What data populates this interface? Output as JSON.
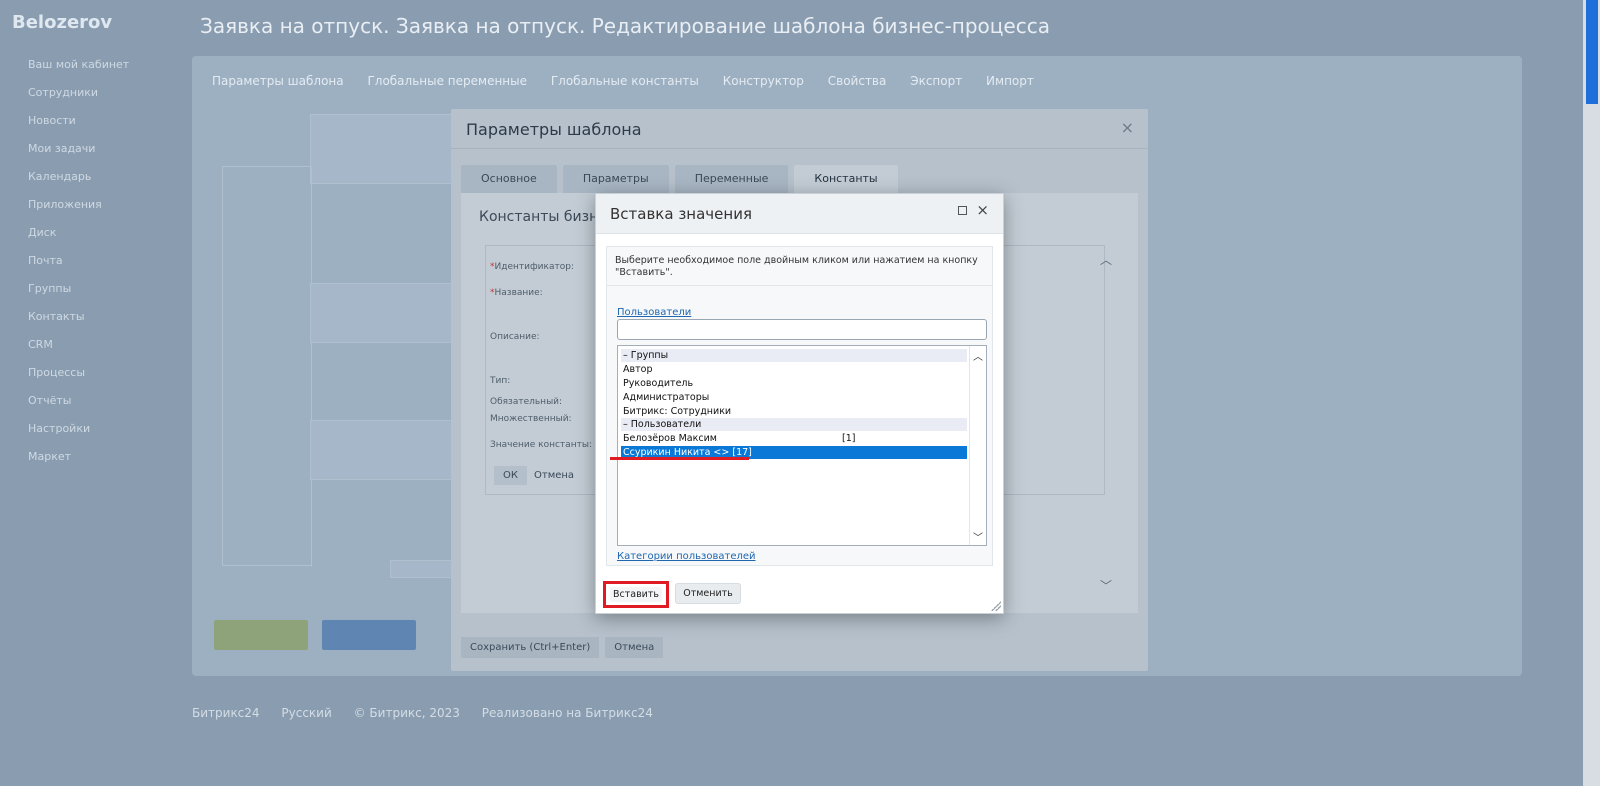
{
  "background": {
    "app_title": "Belozerov",
    "page_title": "Заявка на отпуск. Заявка на отпуск. Редактирование шаблона бизнес-процесса",
    "sidebar_items": [
      "Ваш мой кабинет",
      "Сотрудники",
      "Новости",
      "Мои задачи",
      "Календарь",
      "Приложения",
      "Диск",
      "Почта",
      "Группы",
      "Контакты",
      "CRM",
      "Процессы",
      "Отчёты",
      "Настройки",
      "Маркет"
    ],
    "content_tabs": [
      "Параметры шаблона",
      "Глобальные переменные",
      "Глобальные константы",
      "Конструктор",
      "Свойства",
      "Экспорт",
      "Импорт"
    ],
    "footer": [
      "Битрикс24",
      "Русский",
      "© Битрикс, 2023",
      "Реализовано на Битрикс24"
    ]
  },
  "template_dialog": {
    "title": "Параметры шаблона",
    "close": "×",
    "tabs": [
      {
        "label": "Основное",
        "active": false
      },
      {
        "label": "Параметры",
        "active": false
      },
      {
        "label": "Переменные",
        "active": false
      },
      {
        "label": "Константы",
        "active": true
      }
    ],
    "subtitle": "Константы бизнес",
    "form_labels": {
      "identifier": "Идентификатор:",
      "name": "Название:",
      "description": "Описание:",
      "type": "Тип:",
      "required": "Обязательный:",
      "multiple": "Множественный:",
      "value": "Значение константы:"
    },
    "ok": "ОК",
    "cancel": "Отмена",
    "footer_save": "Сохранить (Ctrl+Enter)",
    "footer_cancel": "Отмена"
  },
  "insert_modal": {
    "title": "Вставка значения",
    "maximize": "",
    "close": "×",
    "hint": "Выберите необходимое поле двойным кликом или нажатием на кнопку \"Вставить\".",
    "users_link": "Пользователи",
    "search_value": "",
    "list": [
      {
        "text": "– Группы",
        "type": "group",
        "id": ""
      },
      {
        "text": "Автор",
        "type": "item",
        "id": ""
      },
      {
        "text": "Руководитель",
        "type": "item",
        "id": ""
      },
      {
        "text": "Администраторы",
        "type": "item",
        "id": ""
      },
      {
        "text": "Битрикс: Сотрудники",
        "type": "item",
        "id": ""
      },
      {
        "text": "– Пользователи",
        "type": "group",
        "id": ""
      },
      {
        "text": "Белозёров Максим",
        "type": "item",
        "id": "[1]"
      },
      {
        "text": "Ссурикин Никита <> [17]",
        "type": "selected",
        "id": ""
      }
    ],
    "categories_link": "Категории пользователей",
    "insert_button": "Вставить",
    "cancel_button": "Отменить"
  },
  "colors": {
    "highlight": "#e01b24",
    "selection": "#0a78d7",
    "link": "#2067b0"
  }
}
